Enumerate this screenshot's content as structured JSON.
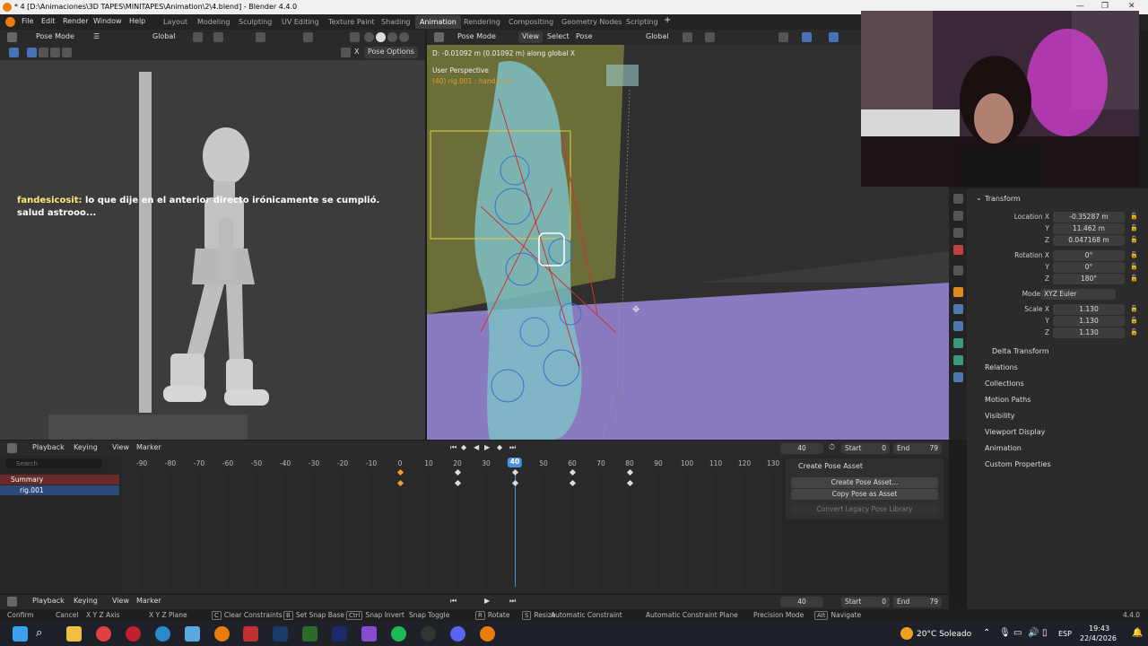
{
  "window": {
    "title": "* 4 [D:\\Animaciones\\3D TAPES\\MINITAPES\\Animation\\2\\4.blend] - Blender 4.4.0"
  },
  "menu": [
    "File",
    "Edit",
    "Render",
    "Window",
    "Help"
  ],
  "workspaces": [
    "Layout",
    "Modeling",
    "Sculpting",
    "UV Editing",
    "Texture Paint",
    "Shading",
    "Animation",
    "Rendering",
    "Compositing",
    "Geometry Nodes",
    "Scripting"
  ],
  "left_viewport": {
    "mode": "Pose Mode",
    "orientation": "Global",
    "pose_options": "Pose Options",
    "axis_label": "X"
  },
  "chat": {
    "user": "fandesicosit:",
    "message": "lo que dije en el anterior directo irónicamente se cumplió. salud astrooo..."
  },
  "right_viewport": {
    "mode": "Pose Mode",
    "menus": [
      "View",
      "Select",
      "Pose"
    ],
    "orientation": "Global",
    "transform_status": "D: -0.01092 m (0.01092 m) along global X",
    "perspective": "User Perspective",
    "object_info": "(40) rig.001 : hand_ik.R"
  },
  "properties": {
    "panel": "Transform",
    "location": {
      "label": "Location X",
      "x": "-0.35287 m",
      "y": "11.462 m",
      "z": "0.047168 m"
    },
    "rotation": {
      "label": "Rotation X",
      "x": "0°",
      "y": "0°",
      "z": "180°"
    },
    "mode": {
      "label": "Mode",
      "value": "XYZ Euler"
    },
    "scale": {
      "label": "Scale X",
      "x": "1.130",
      "y": "1.130",
      "z": "1.130"
    },
    "axis_y": "Y",
    "axis_z": "Z",
    "sections": [
      "Delta Transform",
      "Relations",
      "Collections",
      "Motion Paths",
      "Visibility",
      "Viewport Display",
      "Animation",
      "Custom Properties"
    ]
  },
  "timeline": {
    "menus": [
      "Playback",
      "Keying",
      "View",
      "Marker"
    ],
    "current_frame": "40",
    "start_label": "Start",
    "start": "0",
    "end_label": "End",
    "end": "79",
    "search_placeholder": "Search",
    "channels": [
      "Summary",
      "rig.001"
    ],
    "ticks": [
      "-90",
      "-80",
      "-70",
      "-60",
      "-50",
      "-40",
      "-30",
      "-20",
      "-10",
      "0",
      "10",
      "20",
      "30",
      "40",
      "50",
      "60",
      "70",
      "80",
      "90",
      "100",
      "110",
      "120",
      "130"
    ],
    "keyframes": [
      0,
      20,
      40,
      60,
      80
    ]
  },
  "pose_asset": {
    "title": "Create Pose Asset",
    "buttons": [
      "Create Pose Asset...",
      "Copy Pose as Asset",
      "Convert Legacy Pose Library"
    ]
  },
  "status_bar": {
    "items": [
      "Confirm",
      "Cancel",
      "X Y Z Axis",
      "X Y Z Plane",
      "Clear Constraints",
      "Set Snap Base",
      "Snap Invert",
      "Snap Toggle",
      "Rotate",
      "Resize",
      "Automatic Constraint",
      "Automatic Constraint Plane",
      "Precision Mode",
      "Navigate"
    ],
    "keys": [
      "",
      "",
      "",
      "",
      "C",
      "B",
      "Ctrl",
      "",
      "R",
      "S",
      "",
      "",
      "",
      "Alt"
    ],
    "version": "4.4.0"
  },
  "taskbar": {
    "weather": "20°C  Soleado",
    "lang": "ESP",
    "time": "19:43",
    "date": "22/4/2026"
  }
}
